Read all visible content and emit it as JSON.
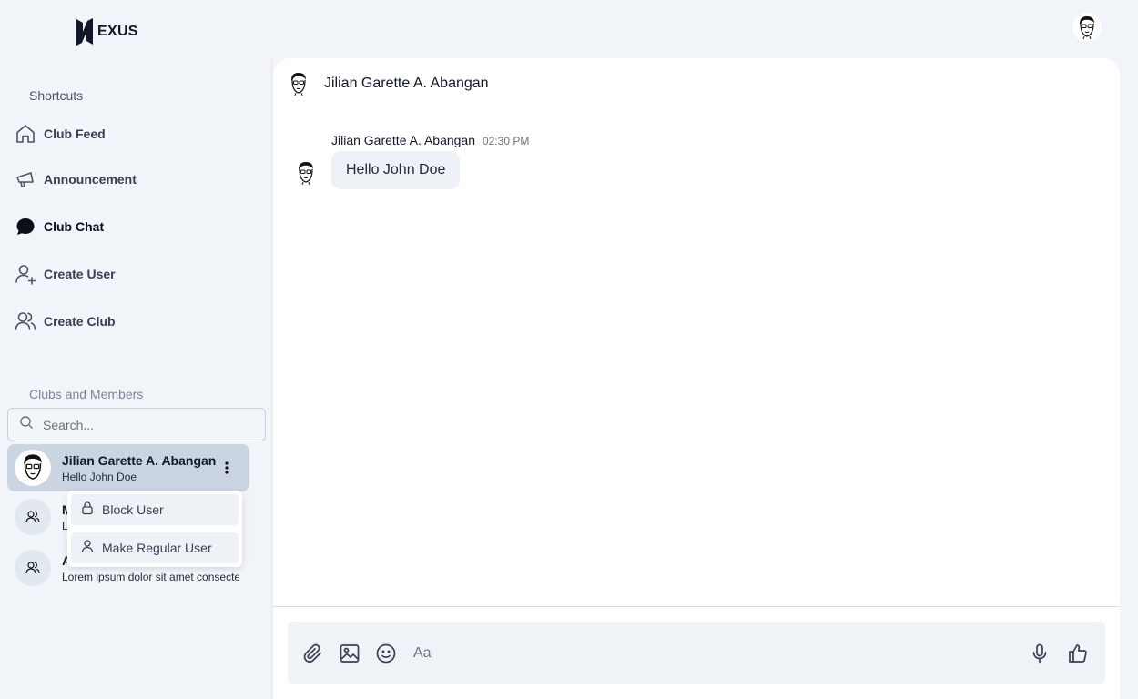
{
  "brand": {
    "name": "EXUS"
  },
  "sidebar": {
    "shortcuts_title": "Shortcuts",
    "items": [
      {
        "label": "Club Feed",
        "icon": "home-icon"
      },
      {
        "label": "Announcement",
        "icon": "megaphone-icon"
      },
      {
        "label": "Club Chat",
        "icon": "chat-bubble-icon",
        "active": true
      },
      {
        "label": "Create User",
        "icon": "user-plus-icon"
      },
      {
        "label": "Create Club",
        "icon": "users-icon"
      }
    ],
    "clubs_title": "Clubs and Members",
    "search": {
      "placeholder": "Search...",
      "value": ""
    },
    "members": [
      {
        "name": "Jilian Garette A. Abangan",
        "sub": "Hello John Doe",
        "selected": true
      },
      {
        "name": "M",
        "sub": "Lo"
      },
      {
        "name": "A",
        "sub": "Lorem ipsum dolor sit amet consecte"
      }
    ],
    "context_menu": [
      {
        "label": "Block User",
        "icon": "lock-icon"
      },
      {
        "label": "Make Regular User",
        "icon": "user-icon"
      }
    ]
  },
  "chat": {
    "header_name": "Jilian Garette A. Abangan",
    "messages": [
      {
        "sender": "Jilian Garette A. Abangan",
        "time": "02:30 PM",
        "text": "Hello John Doe"
      }
    ],
    "composer": {
      "placeholder": "Aa",
      "value": ""
    }
  },
  "colors": {
    "background": "#f1f4f8",
    "selected_member": "#cbd5e1",
    "bubble": "#eef2f7",
    "composer": "#eff2f7"
  }
}
